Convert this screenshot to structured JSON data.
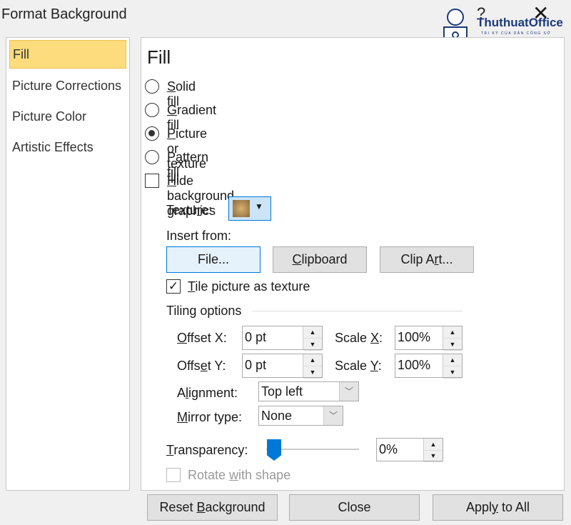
{
  "dialog": {
    "title": "Format Background",
    "help_icon": "question-mark-icon",
    "close_icon": "x-icon"
  },
  "watermark": {
    "brand": "ThuthuatOffice",
    "tagline": "TRI KỶ CỦA DÂN CÔNG SỞ"
  },
  "sidebar": {
    "items": [
      {
        "label": "Fill",
        "selected": true
      },
      {
        "label": "Picture Corrections"
      },
      {
        "label": "Picture Color"
      },
      {
        "label": "Artistic Effects"
      }
    ]
  },
  "fill": {
    "heading": "Fill",
    "options": [
      {
        "label": "Solid fill",
        "u": 0,
        "checked": false
      },
      {
        "label": "Gradient fill",
        "u": 0,
        "checked": false
      },
      {
        "label": "Picture or texture fill",
        "u": 0,
        "checked": true
      },
      {
        "label": "Pattern fill",
        "u": 1,
        "checked": false
      }
    ],
    "hide_bg": {
      "label": "Hide background graphics",
      "u": 0,
      "checked": false
    },
    "texture": {
      "label": "Texture:",
      "u": 5
    },
    "insert_from": "Insert from:",
    "buttons": {
      "file": {
        "label": "File...",
        "u": 0
      },
      "clipboard": {
        "label": "Clipboard",
        "u": 0
      },
      "clipart": {
        "label": "Clip Art...",
        "u": 6
      }
    },
    "tile": {
      "label": "Tile picture as texture",
      "u": 0,
      "checked": true
    },
    "tiling_options": "Tiling options",
    "offset_x": {
      "label": "Offset X:",
      "u": 0,
      "value": "0 pt"
    },
    "offset_y": {
      "label": "Offset Y:",
      "u": 4,
      "value": "0 pt"
    },
    "scale_x": {
      "label": "Scale X:",
      "u": 6,
      "value": "100%"
    },
    "scale_y": {
      "label": "Scale Y:",
      "u": 6,
      "value": "100%"
    },
    "alignment": {
      "label": "Alignment:",
      "u": 1,
      "value": "Top left"
    },
    "mirror": {
      "label": "Mirror type:",
      "u": 0,
      "value": "None"
    },
    "transparency": {
      "label": "Transparency:",
      "u": 0,
      "value": "0%",
      "slider_percent": 0
    },
    "rotate": {
      "label": "Rotate with shape",
      "u": 7,
      "checked": false,
      "disabled": true
    }
  },
  "footer": {
    "reset": {
      "label": "Reset Background",
      "u": 6
    },
    "close": {
      "label": "Close"
    },
    "apply": {
      "label": "Apply to All",
      "u": 4
    }
  },
  "colors": {
    "selected_nav": "#fcdc7c",
    "accent": "#0078d7"
  }
}
